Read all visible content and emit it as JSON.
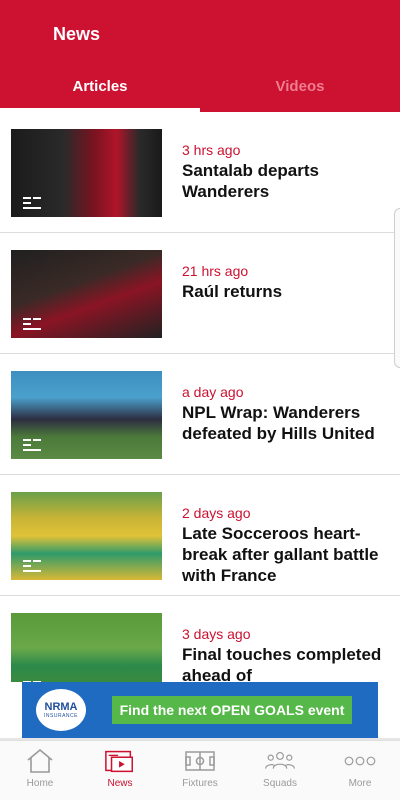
{
  "header": {
    "title": "News",
    "tabs": [
      {
        "label": "Articles",
        "active": true
      },
      {
        "label": "Videos",
        "active": false
      }
    ]
  },
  "articles": [
    {
      "time": "3 hrs ago",
      "title": "Santalab departs Wanderers"
    },
    {
      "time": "21 hrs ago",
      "title": "Raúl returns"
    },
    {
      "time": "a day ago",
      "title": "NPL Wrap: Wanderers defeated by Hills United"
    },
    {
      "time": "2 days ago",
      "title": "Late Socceroos heart-break after gallant battle with France"
    },
    {
      "time": "3 days ago",
      "title": "Final touches completed ahead of"
    }
  ],
  "ad": {
    "logo_line1": "NRMA",
    "logo_line2": "INSURANCE",
    "cta": "Find the next OPEN GOALS event"
  },
  "nav": [
    {
      "label": "Home",
      "icon": "home-icon"
    },
    {
      "label": "News",
      "icon": "news-icon",
      "active": true
    },
    {
      "label": "Fixtures",
      "icon": "pitch-icon"
    },
    {
      "label": "Squads",
      "icon": "people-icon"
    },
    {
      "label": "More",
      "icon": "more-icon"
    }
  ],
  "colors": {
    "brand": "#cc1131",
    "inactive_tab": "#ee7d8f",
    "ad_blue": "#1f6bc1",
    "ad_green": "#55b848"
  }
}
